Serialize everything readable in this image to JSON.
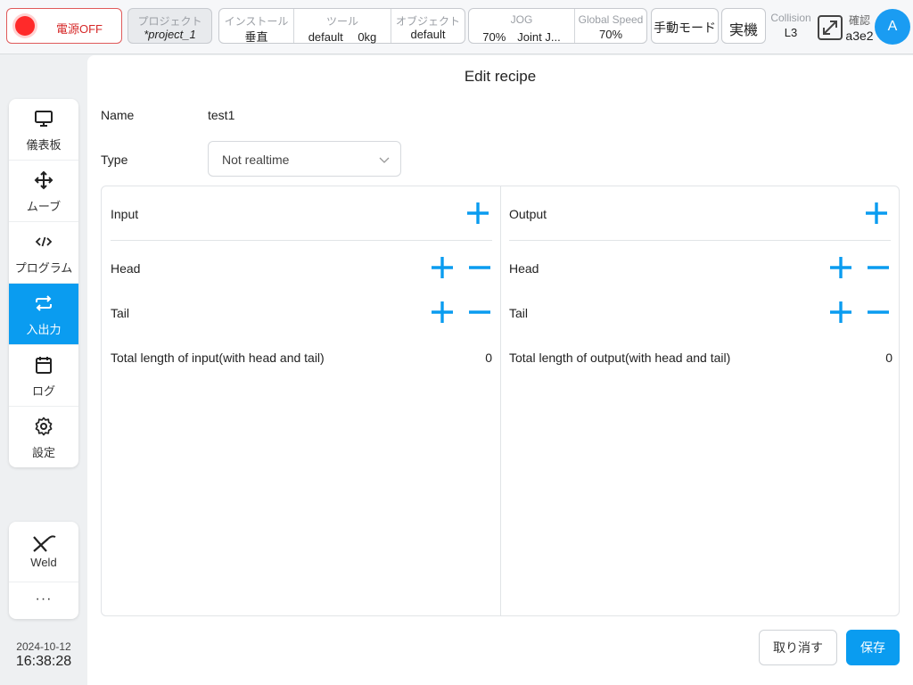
{
  "topbar": {
    "power_label": "電源OFF",
    "project": {
      "title": "プロジェクト",
      "value": "*project_1"
    },
    "install": [
      {
        "title": "インストール",
        "value": "垂直"
      },
      {
        "title": "ツール",
        "value": "default　 0kg"
      },
      {
        "title": "オブジェクト",
        "value": "default"
      }
    ],
    "jog": [
      {
        "title": "JOG",
        "value": "70%　Joint J..."
      },
      {
        "title": "Global Speed",
        "value": "70%"
      }
    ],
    "manual_mode": "手動モード",
    "real_robot": "実機",
    "collision": {
      "title": "Collision",
      "value": "L3"
    },
    "confirm": {
      "title": "確認",
      "value": "a3e2"
    },
    "avatar": "A",
    "colors": {
      "accent": "#0a9cf0",
      "power": "#ff2a2a"
    }
  },
  "sidebar": {
    "items": [
      {
        "label": "儀表板",
        "icon": "monitor-icon"
      },
      {
        "label": "ムーブ",
        "icon": "move-icon"
      },
      {
        "label": "プログラム",
        "icon": "code-icon"
      },
      {
        "label": "入出力",
        "icon": "io-arrows-icon",
        "active": true
      },
      {
        "label": "ログ",
        "icon": "calendar-icon"
      },
      {
        "label": "設定",
        "icon": "gear-icon"
      }
    ],
    "weld_label": "Weld",
    "more_label": "···",
    "date": "2024-10-12",
    "time": "16:38:28"
  },
  "recipe": {
    "title": "Edit recipe",
    "name_label": "Name",
    "name_value": "test1",
    "type_label": "Type",
    "type_value": "Not realtime",
    "input": {
      "label": "Input",
      "head_label": "Head",
      "tail_label": "Tail",
      "total_label": "Total length of input(with head and tail)",
      "total_value": "0"
    },
    "output": {
      "label": "Output",
      "head_label": "Head",
      "tail_label": "Tail",
      "total_label": "Total length of output(with head and tail)",
      "total_value": "0"
    },
    "cancel_label": "取り消す",
    "save_label": "保存"
  }
}
